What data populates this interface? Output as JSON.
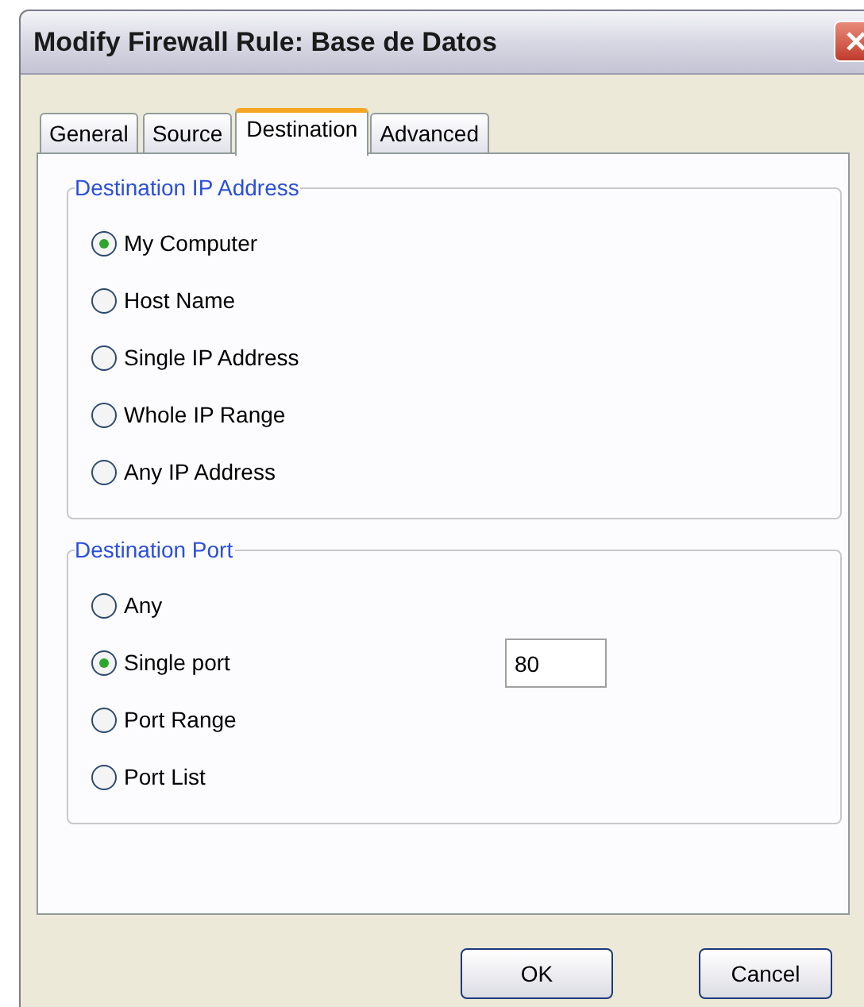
{
  "window": {
    "title": "Modify Firewall Rule: Base de Datos"
  },
  "tabs": [
    {
      "label": "General",
      "selected": false
    },
    {
      "label": "Source",
      "selected": false
    },
    {
      "label": "Destination",
      "selected": true
    },
    {
      "label": "Advanced",
      "selected": false
    }
  ],
  "groups": [
    {
      "title": "Destination IP Address",
      "options": [
        {
          "label": "My Computer",
          "selected": true
        },
        {
          "label": "Host Name",
          "selected": false
        },
        {
          "label": "Single IP Address",
          "selected": false
        },
        {
          "label": "Whole IP Range",
          "selected": false
        },
        {
          "label": "Any IP Address",
          "selected": false
        }
      ]
    },
    {
      "title": "Destination Port",
      "options": [
        {
          "label": "Any",
          "selected": false
        },
        {
          "label": "Single port",
          "selected": true,
          "value": "80"
        },
        {
          "label": "Port Range",
          "selected": false
        },
        {
          "label": "Port List",
          "selected": false
        }
      ]
    }
  ],
  "buttons": [
    "OK",
    "Cancel"
  ]
}
